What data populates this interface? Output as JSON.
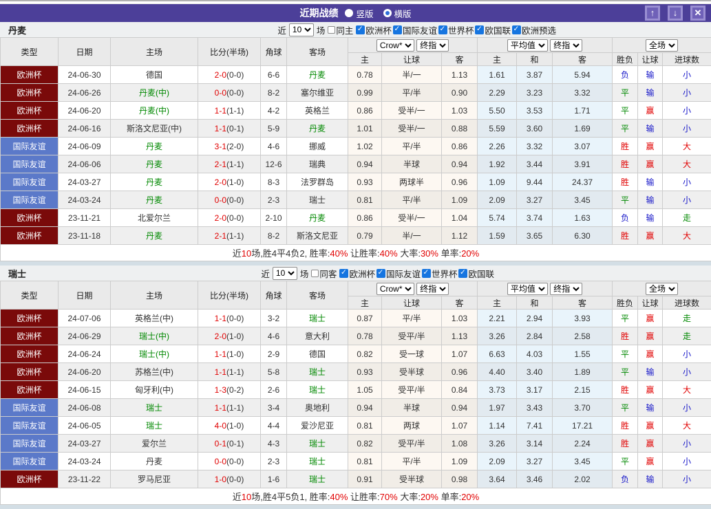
{
  "title_bar": {
    "title": "近期战绩",
    "radio_vertical": "竖版",
    "radio_horizontal": "横版",
    "up_button": "↑",
    "down_button": "↓",
    "close_button": "✕"
  },
  "colors": {
    "accent_purple": "#4c3f99",
    "euro_badge": "#7a0a0a",
    "friendly_badge": "#5b79c9",
    "win_red": "#e10000",
    "draw_green": "#008800",
    "lose_blue": "#1515c8"
  },
  "filter": {
    "near": "近",
    "matches": "场"
  },
  "header": {
    "col_type": "类型",
    "col_date": "日期",
    "col_home": "主场",
    "col_score": "比分(半场)",
    "col_corner": "角球",
    "col_away": "客场",
    "dd_crow": "Crow*",
    "dd_final1": "终指",
    "dd_avg": "平均值",
    "dd_final2": "终指",
    "dd_scope": "全场",
    "sub": [
      "主",
      "让球",
      "客",
      "主",
      "和",
      "客",
      "胜负",
      "让球",
      "进球数"
    ]
  },
  "sections": [
    {
      "team": "丹麦",
      "near_value": "10",
      "same_label": "同主",
      "same_checked": false,
      "leagues": [
        "欧洲杯",
        "国际友谊",
        "世界杯",
        "欧国联",
        "欧洲预选"
      ],
      "rows": [
        {
          "lt": "euro",
          "league": "欧洲杯",
          "date": "24-06-30",
          "home": "德国",
          "ha": false,
          "ft": "2-0",
          "ht": "(0-0)",
          "corner": "6-6",
          "away": "丹麦",
          "aa": true,
          "odds": [
            "0.78",
            "半/一",
            "1.13"
          ],
          "avg": [
            "1.61",
            "3.87",
            "5.94"
          ],
          "res": [
            [
              "负",
              "b"
            ],
            [
              "输",
              "b"
            ],
            [
              "小",
              "b"
            ]
          ]
        },
        {
          "lt": "euro",
          "league": "欧洲杯",
          "date": "24-06-26",
          "home": "丹麦(中)",
          "ha": true,
          "ft": "0-0",
          "ht": "(0-0)",
          "corner": "8-2",
          "away": "塞尔维亚",
          "aa": false,
          "odds": [
            "0.99",
            "平/半",
            "0.90"
          ],
          "avg": [
            "2.29",
            "3.23",
            "3.32"
          ],
          "res": [
            [
              "平",
              "g"
            ],
            [
              "输",
              "b"
            ],
            [
              "小",
              "b"
            ]
          ]
        },
        {
          "lt": "euro",
          "league": "欧洲杯",
          "date": "24-06-20",
          "home": "丹麦(中)",
          "ha": true,
          "ft": "1-1",
          "ht": "(1-1)",
          "corner": "4-2",
          "away": "英格兰",
          "aa": false,
          "odds": [
            "0.86",
            "受半/一",
            "1.03"
          ],
          "avg": [
            "5.50",
            "3.53",
            "1.71"
          ],
          "res": [
            [
              "平",
              "g"
            ],
            [
              "赢",
              "r"
            ],
            [
              "小",
              "b"
            ]
          ]
        },
        {
          "lt": "euro",
          "league": "欧洲杯",
          "date": "24-06-16",
          "home": "斯洛文尼亚(中)",
          "ha": false,
          "ft": "1-1",
          "ht": "(0-1)",
          "corner": "5-9",
          "away": "丹麦",
          "aa": true,
          "odds": [
            "1.01",
            "受半/一",
            "0.88"
          ],
          "avg": [
            "5.59",
            "3.60",
            "1.69"
          ],
          "res": [
            [
              "平",
              "g"
            ],
            [
              "输",
              "b"
            ],
            [
              "小",
              "b"
            ]
          ]
        },
        {
          "lt": "friendly",
          "league": "国际友谊",
          "date": "24-06-09",
          "home": "丹麦",
          "ha": true,
          "ft": "3-1",
          "ht": "(2-0)",
          "corner": "4-6",
          "away": "挪威",
          "aa": false,
          "odds": [
            "1.02",
            "平/半",
            "0.86"
          ],
          "avg": [
            "2.26",
            "3.32",
            "3.07"
          ],
          "res": [
            [
              "胜",
              "r"
            ],
            [
              "赢",
              "r"
            ],
            [
              "大",
              "r"
            ]
          ]
        },
        {
          "lt": "friendly",
          "league": "国际友谊",
          "date": "24-06-06",
          "home": "丹麦",
          "ha": true,
          "ft": "2-1",
          "ht": "(1-1)",
          "corner": "12-6",
          "away": "瑞典",
          "aa": false,
          "odds": [
            "0.94",
            "半球",
            "0.94"
          ],
          "avg": [
            "1.92",
            "3.44",
            "3.91"
          ],
          "res": [
            [
              "胜",
              "r"
            ],
            [
              "赢",
              "r"
            ],
            [
              "大",
              "r"
            ]
          ]
        },
        {
          "lt": "friendly",
          "league": "国际友谊",
          "date": "24-03-27",
          "home": "丹麦",
          "ha": true,
          "ft": "2-0",
          "ht": "(1-0)",
          "corner": "8-3",
          "away": "法罗群岛",
          "aa": false,
          "odds": [
            "0.93",
            "两球半",
            "0.96"
          ],
          "avg": [
            "1.09",
            "9.44",
            "24.37"
          ],
          "res": [
            [
              "胜",
              "r"
            ],
            [
              "输",
              "b"
            ],
            [
              "小",
              "b"
            ]
          ]
        },
        {
          "lt": "friendly",
          "league": "国际友谊",
          "date": "24-03-24",
          "home": "丹麦",
          "ha": true,
          "ft": "0-0",
          "ht": "(0-0)",
          "corner": "2-3",
          "away": "瑞士",
          "aa": false,
          "odds": [
            "0.81",
            "平/半",
            "1.09"
          ],
          "avg": [
            "2.09",
            "3.27",
            "3.45"
          ],
          "res": [
            [
              "平",
              "g"
            ],
            [
              "输",
              "b"
            ],
            [
              "小",
              "b"
            ]
          ]
        },
        {
          "lt": "euro",
          "league": "欧洲杯",
          "date": "23-11-21",
          "home": "北爱尔兰",
          "ha": false,
          "ft": "2-0",
          "ht": "(0-0)",
          "corner": "2-10",
          "away": "丹麦",
          "aa": true,
          "odds": [
            "0.86",
            "受半/一",
            "1.04"
          ],
          "avg": [
            "5.74",
            "3.74",
            "1.63"
          ],
          "res": [
            [
              "负",
              "b"
            ],
            [
              "输",
              "b"
            ],
            [
              "走",
              "g"
            ]
          ]
        },
        {
          "lt": "euro",
          "league": "欧洲杯",
          "date": "23-11-18",
          "home": "丹麦",
          "ha": true,
          "ft": "2-1",
          "ht": "(1-1)",
          "corner": "8-2",
          "away": "斯洛文尼亚",
          "aa": false,
          "odds": [
            "0.79",
            "半/一",
            "1.12"
          ],
          "avg": [
            "1.59",
            "3.65",
            "6.30"
          ],
          "res": [
            [
              "胜",
              "r"
            ],
            [
              "赢",
              "r"
            ],
            [
              "大",
              "r"
            ]
          ]
        }
      ],
      "summary": [
        [
          "近",
          "k"
        ],
        [
          "10",
          "r"
        ],
        [
          "场,胜4平4负2, 胜率:",
          "k"
        ],
        [
          "40%",
          "r"
        ],
        [
          " 让胜率:",
          "k"
        ],
        [
          "40%",
          "r"
        ],
        [
          " 大率:",
          "k"
        ],
        [
          "30%",
          "r"
        ],
        [
          " 单率:",
          "k"
        ],
        [
          "20%",
          "r"
        ]
      ]
    },
    {
      "team": "瑞士",
      "near_value": "10",
      "same_label": "同客",
      "same_checked": false,
      "leagues": [
        "欧洲杯",
        "国际友谊",
        "世界杯",
        "欧国联"
      ],
      "rows": [
        {
          "lt": "euro",
          "league": "欧洲杯",
          "date": "24-07-06",
          "home": "英格兰(中)",
          "ha": false,
          "ft": "1-1",
          "ht": "(0-0)",
          "corner": "3-2",
          "away": "瑞士",
          "aa": true,
          "odds": [
            "0.87",
            "平/半",
            "1.03"
          ],
          "avg": [
            "2.21",
            "2.94",
            "3.93"
          ],
          "res": [
            [
              "平",
              "g"
            ],
            [
              "赢",
              "r"
            ],
            [
              "走",
              "g"
            ]
          ]
        },
        {
          "lt": "euro",
          "league": "欧洲杯",
          "date": "24-06-29",
          "home": "瑞士(中)",
          "ha": true,
          "ft": "2-0",
          "ht": "(1-0)",
          "corner": "4-6",
          "away": "意大利",
          "aa": false,
          "odds": [
            "0.78",
            "受平/半",
            "1.13"
          ],
          "avg": [
            "3.26",
            "2.84",
            "2.58"
          ],
          "res": [
            [
              "胜",
              "r"
            ],
            [
              "赢",
              "r"
            ],
            [
              "走",
              "g"
            ]
          ]
        },
        {
          "lt": "euro",
          "league": "欧洲杯",
          "date": "24-06-24",
          "home": "瑞士(中)",
          "ha": true,
          "ft": "1-1",
          "ht": "(1-0)",
          "corner": "2-9",
          "away": "德国",
          "aa": false,
          "odds": [
            "0.82",
            "受一球",
            "1.07"
          ],
          "avg": [
            "6.63",
            "4.03",
            "1.55"
          ],
          "res": [
            [
              "平",
              "g"
            ],
            [
              "赢",
              "r"
            ],
            [
              "小",
              "b"
            ]
          ]
        },
        {
          "lt": "euro",
          "league": "欧洲杯",
          "date": "24-06-20",
          "home": "苏格兰(中)",
          "ha": false,
          "ft": "1-1",
          "ht": "(1-1)",
          "corner": "5-8",
          "away": "瑞士",
          "aa": true,
          "odds": [
            "0.93",
            "受半球",
            "0.96"
          ],
          "avg": [
            "4.40",
            "3.40",
            "1.89"
          ],
          "res": [
            [
              "平",
              "g"
            ],
            [
              "输",
              "b"
            ],
            [
              "小",
              "b"
            ]
          ]
        },
        {
          "lt": "euro",
          "league": "欧洲杯",
          "date": "24-06-15",
          "home": "匈牙利(中)",
          "ha": false,
          "ft": "1-3",
          "ht": "(0-2)",
          "corner": "2-6",
          "away": "瑞士",
          "aa": true,
          "odds": [
            "1.05",
            "受平/半",
            "0.84"
          ],
          "avg": [
            "3.73",
            "3.17",
            "2.15"
          ],
          "res": [
            [
              "胜",
              "r"
            ],
            [
              "赢",
              "r"
            ],
            [
              "大",
              "r"
            ]
          ]
        },
        {
          "lt": "friendly",
          "league": "国际友谊",
          "date": "24-06-08",
          "home": "瑞士",
          "ha": true,
          "ft": "1-1",
          "ht": "(1-1)",
          "corner": "3-4",
          "away": "奥地利",
          "aa": false,
          "odds": [
            "0.94",
            "半球",
            "0.94"
          ],
          "avg": [
            "1.97",
            "3.43",
            "3.70"
          ],
          "res": [
            [
              "平",
              "g"
            ],
            [
              "输",
              "b"
            ],
            [
              "小",
              "b"
            ]
          ]
        },
        {
          "lt": "friendly",
          "league": "国际友谊",
          "date": "24-06-05",
          "home": "瑞士",
          "ha": true,
          "ft": "4-0",
          "ht": "(1-0)",
          "corner": "4-4",
          "away": "爱沙尼亚",
          "aa": false,
          "odds": [
            "0.81",
            "两球",
            "1.07"
          ],
          "avg": [
            "1.14",
            "7.41",
            "17.21"
          ],
          "res": [
            [
              "胜",
              "r"
            ],
            [
              "赢",
              "r"
            ],
            [
              "大",
              "r"
            ]
          ]
        },
        {
          "lt": "friendly",
          "league": "国际友谊",
          "date": "24-03-27",
          "home": "爱尔兰",
          "ha": false,
          "ft": "0-1",
          "ht": "(0-1)",
          "corner": "4-3",
          "away": "瑞士",
          "aa": true,
          "odds": [
            "0.82",
            "受平/半",
            "1.08"
          ],
          "avg": [
            "3.26",
            "3.14",
            "2.24"
          ],
          "res": [
            [
              "胜",
              "r"
            ],
            [
              "赢",
              "r"
            ],
            [
              "小",
              "b"
            ]
          ]
        },
        {
          "lt": "friendly",
          "league": "国际友谊",
          "date": "24-03-24",
          "home": "丹麦",
          "ha": false,
          "ft": "0-0",
          "ht": "(0-0)",
          "corner": "2-3",
          "away": "瑞士",
          "aa": true,
          "odds": [
            "0.81",
            "平/半",
            "1.09"
          ],
          "avg": [
            "2.09",
            "3.27",
            "3.45"
          ],
          "res": [
            [
              "平",
              "g"
            ],
            [
              "赢",
              "r"
            ],
            [
              "小",
              "b"
            ]
          ]
        },
        {
          "lt": "euro",
          "league": "欧洲杯",
          "date": "23-11-22",
          "home": "罗马尼亚",
          "ha": false,
          "ft": "1-0",
          "ht": "(0-0)",
          "corner": "1-6",
          "away": "瑞士",
          "aa": true,
          "odds": [
            "0.91",
            "受半球",
            "0.98"
          ],
          "avg": [
            "3.64",
            "3.46",
            "2.02"
          ],
          "res": [
            [
              "负",
              "b"
            ],
            [
              "输",
              "b"
            ],
            [
              "小",
              "b"
            ]
          ]
        }
      ],
      "summary": [
        [
          "近",
          "k"
        ],
        [
          "10",
          "r"
        ],
        [
          "场,胜4平5负1, 胜率:",
          "k"
        ],
        [
          "40%",
          "r"
        ],
        [
          " 让胜率:",
          "k"
        ],
        [
          "70%",
          "r"
        ],
        [
          " 大率:",
          "k"
        ],
        [
          "20%",
          "r"
        ],
        [
          " 单率:",
          "k"
        ],
        [
          "20%",
          "r"
        ]
      ]
    }
  ]
}
